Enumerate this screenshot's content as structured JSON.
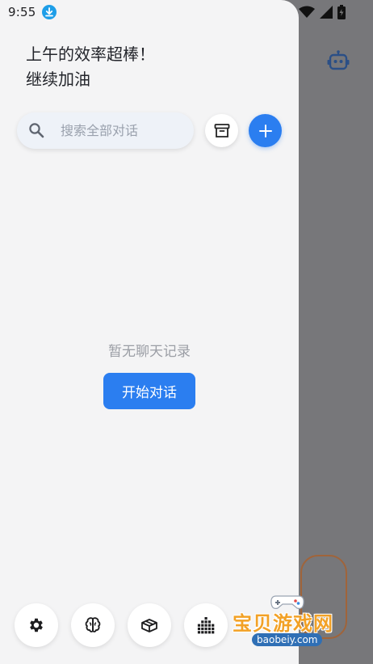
{
  "status": {
    "time": "9:55"
  },
  "greeting": {
    "line1": "上午的效率超棒！",
    "line2": "继续加油"
  },
  "search": {
    "placeholder": "搜索全部对话",
    "value": ""
  },
  "empty_state": {
    "message": "暂无聊天记录",
    "start_label": "开始对话"
  },
  "icons": {
    "download": "download-icon",
    "search": "search-icon",
    "archive": "archive-icon",
    "new_chat": "plus-icon",
    "bottom": [
      "gear-icon",
      "brain-icon",
      "box-icon",
      "dots-grid-icon"
    ],
    "background": "robot-icon"
  },
  "watermark": {
    "title": "宝贝游戏网",
    "url": "baobeiy.com"
  },
  "colors": {
    "accent": "#2b7ef0",
    "drawer_bg": "#f4f4f5",
    "scrim": "#77777a",
    "watermark": "#f2a126"
  }
}
